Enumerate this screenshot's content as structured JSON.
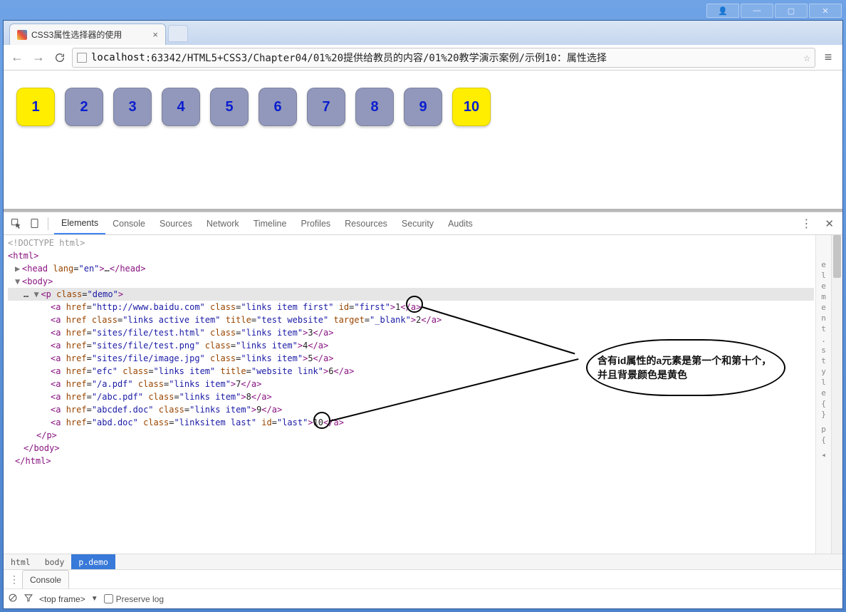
{
  "os_buttons": {
    "user": "👤",
    "min": "—",
    "max": "▢",
    "close": "✕"
  },
  "tab": {
    "title": "CSS3属性选择器的使用",
    "close": "×"
  },
  "nav": {
    "back": "←",
    "forward": "→"
  },
  "address": {
    "host": "localhost",
    "path": ":63342/HTML5+CSS3/Chapter04/01%20提供给教员的内容/01%20教学演示案例/示例10：属性选择"
  },
  "menu_glyph": "≡",
  "demo_items": [
    {
      "label": "1",
      "yellow": true
    },
    {
      "label": "2",
      "yellow": false
    },
    {
      "label": "3",
      "yellow": false
    },
    {
      "label": "4",
      "yellow": false
    },
    {
      "label": "5",
      "yellow": false
    },
    {
      "label": "6",
      "yellow": false
    },
    {
      "label": "7",
      "yellow": false
    },
    {
      "label": "8",
      "yellow": false
    },
    {
      "label": "9",
      "yellow": false
    },
    {
      "label": "10",
      "yellow": true
    }
  ],
  "devtools_tabs": [
    "Elements",
    "Console",
    "Sources",
    "Network",
    "Timeline",
    "Profiles",
    "Resources",
    "Security",
    "Audits"
  ],
  "devtools_active_tab": "Elements",
  "dom_source": {
    "doctype": "<!DOCTYPE html>",
    "html_open": "html",
    "head": {
      "tag": "head",
      "attrs": [
        [
          "lang",
          "en"
        ]
      ]
    },
    "body_open": "body",
    "p": {
      "tag": "p",
      "attrs": [
        [
          "class",
          "demo"
        ]
      ]
    },
    "anchors": [
      {
        "attrs": [
          [
            "href",
            "http://www.baidu.com"
          ],
          [
            "class",
            "links item first"
          ],
          [
            "id",
            "first"
          ]
        ],
        "text": "1"
      },
      {
        "attrs": [
          [
            "href",
            ""
          ],
          [
            "class",
            "links active item"
          ],
          [
            "title",
            "test website"
          ],
          [
            "target",
            "_blank"
          ]
        ],
        "text": "2"
      },
      {
        "attrs": [
          [
            "href",
            "sites/file/test.html"
          ],
          [
            "class",
            "links item"
          ]
        ],
        "text": "3"
      },
      {
        "attrs": [
          [
            "href",
            "sites/file/test.png"
          ],
          [
            "class",
            "links item"
          ]
        ],
        "text": "4"
      },
      {
        "attrs": [
          [
            "href",
            "sites/file/image.jpg"
          ],
          [
            "class",
            "links item"
          ]
        ],
        "text": "5"
      },
      {
        "attrs": [
          [
            "href",
            "efc"
          ],
          [
            "class",
            "links item"
          ],
          [
            "title",
            "website link"
          ]
        ],
        "text": "6"
      },
      {
        "attrs": [
          [
            "href",
            "/a.pdf"
          ],
          [
            "class",
            "links item"
          ]
        ],
        "text": "7"
      },
      {
        "attrs": [
          [
            "href",
            "/abc.pdf"
          ],
          [
            "class",
            "links item"
          ]
        ],
        "text": "8"
      },
      {
        "attrs": [
          [
            "href",
            "abcdef.doc"
          ],
          [
            "class",
            "links item"
          ]
        ],
        "text": "9"
      },
      {
        "attrs": [
          [
            "href",
            "abd.doc"
          ],
          [
            "class",
            "linksitem last"
          ],
          [
            "id",
            "last"
          ]
        ],
        "text": "10"
      }
    ]
  },
  "side_rail": "element.style { } p {  ",
  "side_chevron": "»",
  "breadcrumbs": [
    {
      "label": "html",
      "active": false
    },
    {
      "label": "body",
      "active": false
    },
    {
      "label": "p.demo",
      "active": true
    }
  ],
  "drawer": {
    "tab": "Console"
  },
  "console_bar": {
    "frame": "<top frame>",
    "preserve": "Preserve log"
  },
  "callout_text": "含有id属性的a元素是第一个和第十个，并且背景颜色是黄色"
}
